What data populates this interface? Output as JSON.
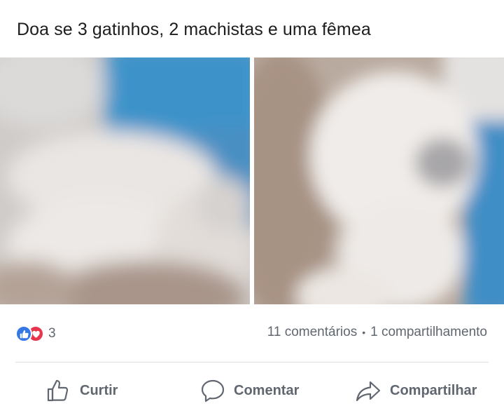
{
  "post": {
    "text": "Doa se 3 gatinhos, 2 machistas e uma fêmea"
  },
  "photos": [
    {
      "icon": "kitten-photo-left"
    },
    {
      "icon": "kitten-photo-right"
    }
  ],
  "reactions": {
    "icons": [
      "like-reaction-icon",
      "love-reaction-icon"
    ],
    "count": "3"
  },
  "stats": {
    "comments": "11 comentários",
    "separator": "•",
    "shares": "1 compartilhamento"
  },
  "actions": {
    "like_label": "Curtir",
    "comment_label": "Comentar",
    "share_label": "Compartilhar"
  },
  "colors": {
    "like_blue": "#3578e5",
    "love_red": "#e8344c",
    "secondary_text": "#606770",
    "divider": "#dadde1"
  }
}
